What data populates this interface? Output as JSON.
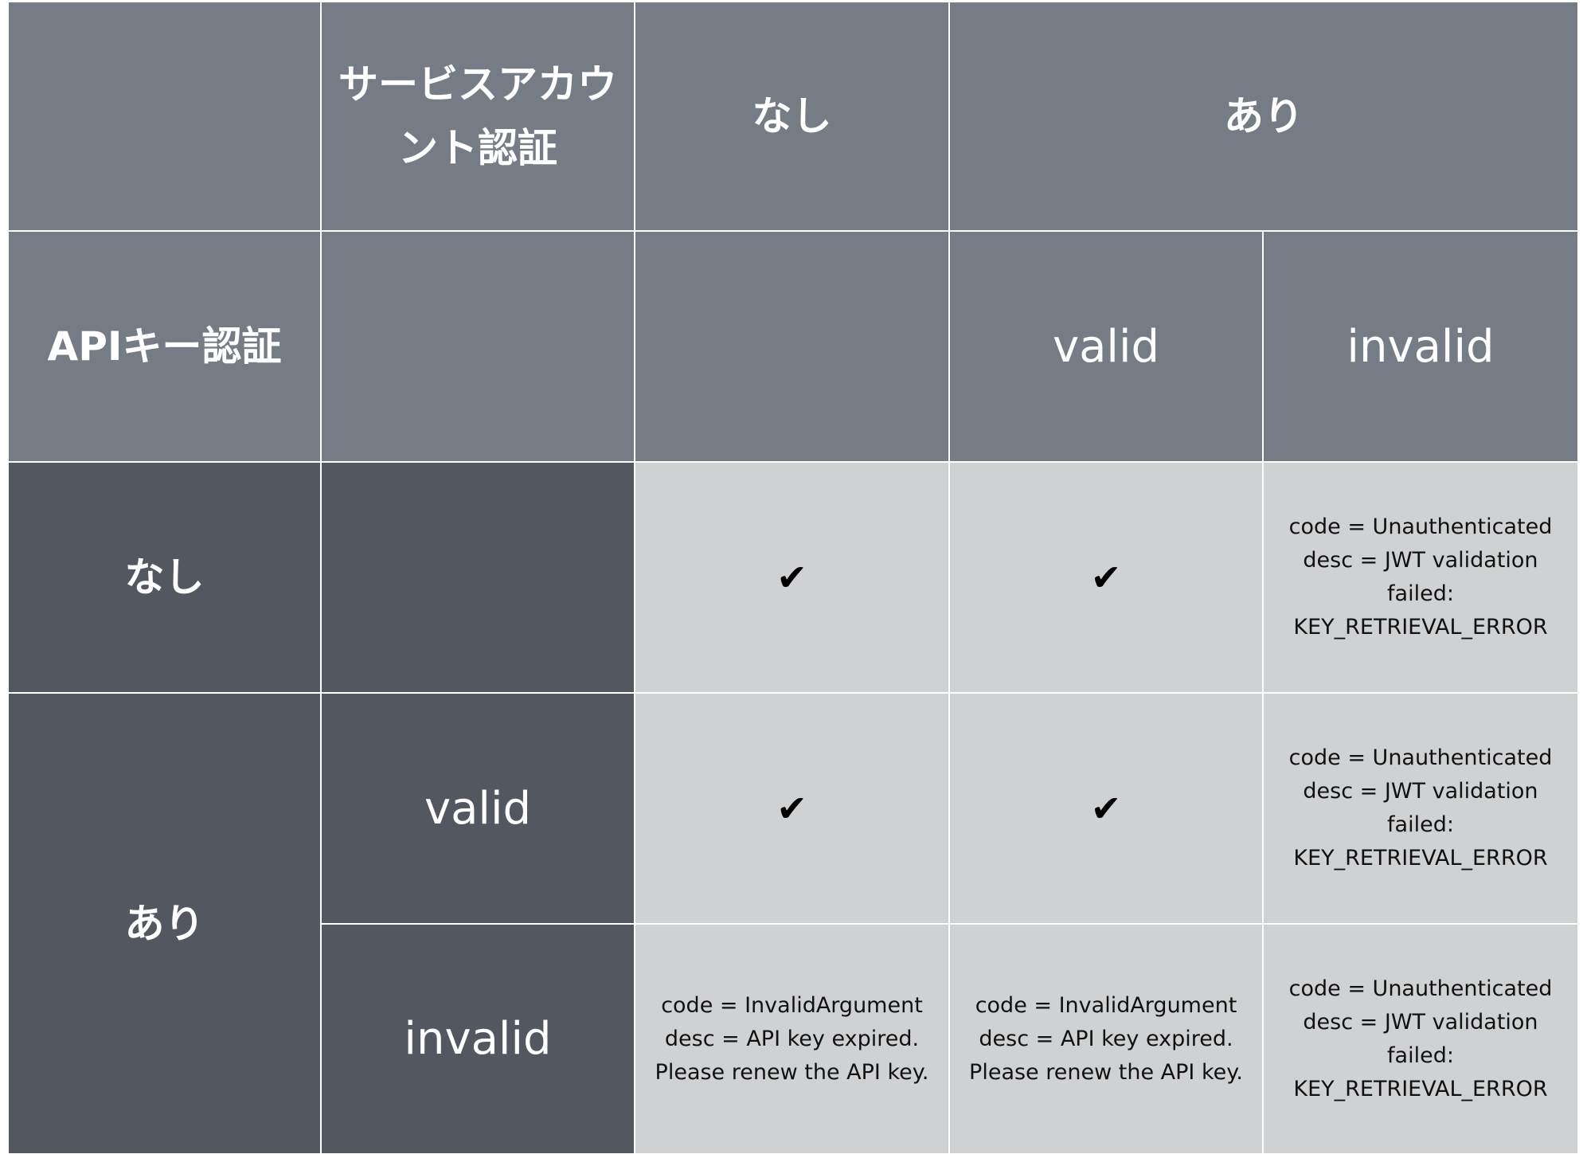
{
  "colors": {
    "header_bg": "#767c85",
    "row_header_bg": "#53575f",
    "body_bg": "#d0d1d3",
    "gridline": "#ffffff"
  },
  "header": {
    "corner": "",
    "service_account_title": "サービスアカウント認証",
    "sa_none": "なし",
    "sa_present": "あり",
    "api_key_title": "APIキー認証",
    "sa_valid": "valid",
    "sa_invalid": "invalid"
  },
  "rows": {
    "api_none": "なし",
    "api_present": "あり",
    "api_valid": "valid",
    "api_invalid": "invalid"
  },
  "icons": {
    "check": "✔"
  },
  "cells": {
    "none_none": "✔",
    "none_valid": "✔",
    "none_invalid": "code = Unauthenticated\ndesc = JWT validation\nfailed:\nKEY_RETRIEVAL_ERROR",
    "valid_none": "✔",
    "valid_valid": "✔",
    "valid_invalid": "code = Unauthenticated\ndesc = JWT validation\nfailed:\nKEY_RETRIEVAL_ERROR",
    "invalid_none": "code = InvalidArgument\ndesc = API key expired.\nPlease renew the API key.",
    "invalid_valid": "code = InvalidArgument\ndesc = API key expired.\nPlease renew the API key.",
    "invalid_invalid": "code = Unauthenticated\ndesc = JWT validation\nfailed:\nKEY_RETRIEVAL_ERROR"
  }
}
